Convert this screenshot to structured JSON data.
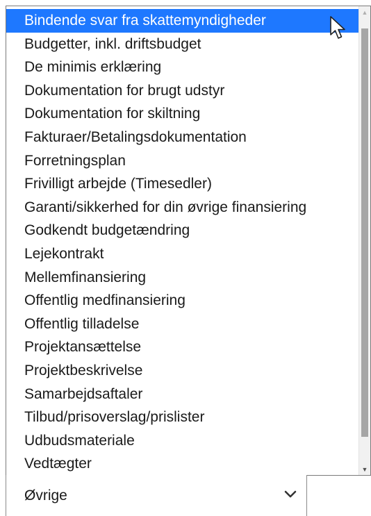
{
  "dropdown": {
    "options": [
      "Bindende svar fra skattemyndigheder",
      "Budgetter, inkl. driftsbudget",
      "De minimis erklæring",
      "Dokumentation for brugt udstyr",
      "Dokumentation for skiltning",
      "Fakturaer/Betalingsdokumentation",
      "Forretningsplan",
      "Frivilligt arbejde (Timesedler)",
      "Garanti/sikkerhed for din øvrige finansiering",
      "Godkendt budgetændring",
      "Lejekontrakt",
      "Mellemfinansiering",
      "Offentlig medfinansiering",
      "Offentlig tilladelse",
      "Projektansættelse",
      "Projektbeskrivelse",
      "Samarbejdsaftaler",
      "Tilbud/prisoverslag/prislister",
      "Udbudsmateriale",
      "Vedtægter"
    ],
    "highlighted_option": "Bindende svar fra skattemyndigheder",
    "highlight_color": "#1e78ff"
  },
  "select": {
    "current_value": "Øvrige",
    "chevron_icon": "chevron-down-icon"
  },
  "scrollbar": {
    "up_icon": "scroll-up-arrow-icon",
    "down_icon": "scroll-down-arrow-icon"
  },
  "cursor": {
    "icon": "mouse-pointer-icon"
  }
}
